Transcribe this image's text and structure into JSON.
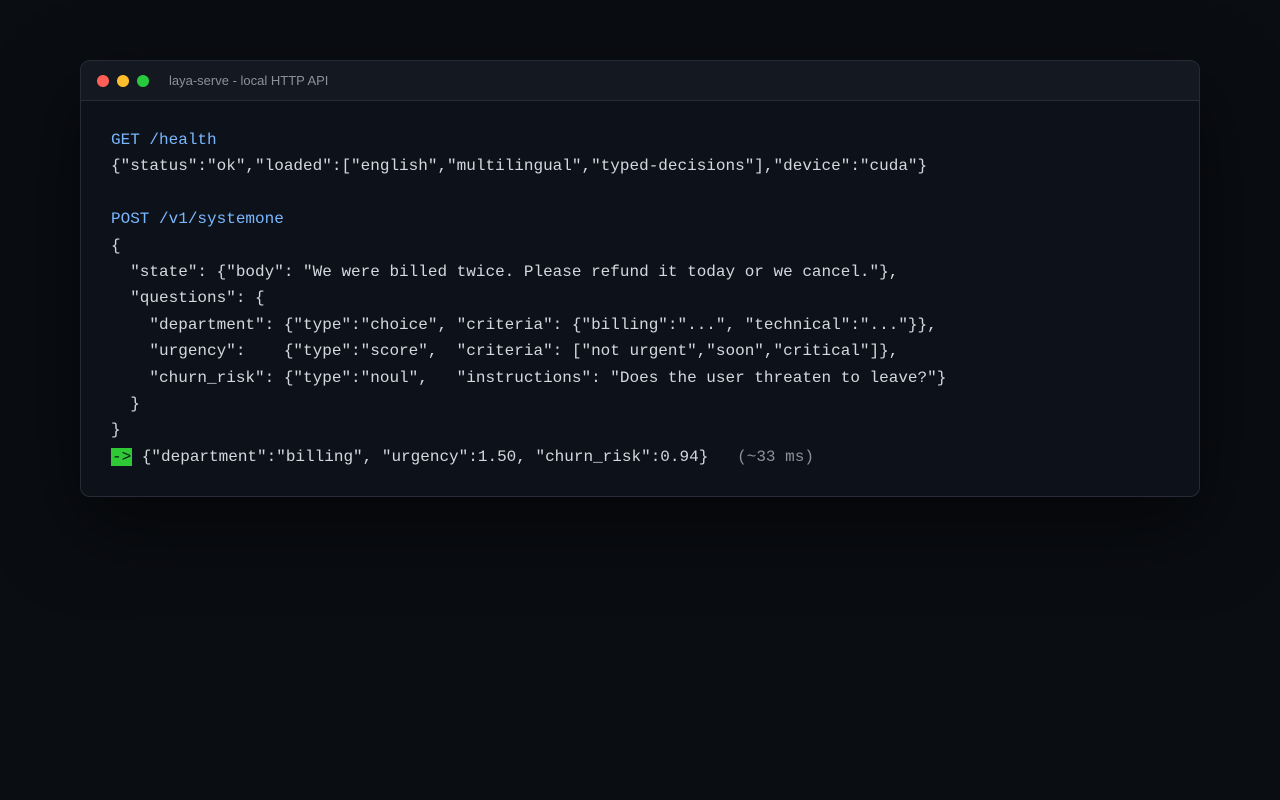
{
  "window": {
    "title": "laya-serve - local HTTP API"
  },
  "colors": {
    "background": "#0a0d12",
    "window_bg": "#0d111a",
    "method_blue": "#79b8ff",
    "arrow_green": "#2fc936",
    "text": "#d4d7dd",
    "muted": "#8a909c",
    "traffic_red": "#ff5f56",
    "traffic_yellow": "#ffbd2e",
    "traffic_green": "#27c93f"
  },
  "terminal": {
    "health_request": "GET /health",
    "health_response": "{\"status\":\"ok\",\"loaded\":[\"english\",\"multilingual\",\"typed-decisions\"],\"device\":\"cuda\"}",
    "post_request": "POST /v1/systemone",
    "body_lines": [
      "{",
      "  \"state\": {\"body\": \"We were billed twice. Please refund it today or we cancel.\"},",
      "  \"questions\": {",
      "    \"department\": {\"type\":\"choice\", \"criteria\": {\"billing\":\"...\", \"technical\":\"...\"}},",
      "    \"urgency\":    {\"type\":\"score\",  \"criteria\": [\"not urgent\",\"soon\",\"critical\"]},",
      "    \"churn_risk\": {\"type\":\"noul\",   \"instructions\": \"Does the user threaten to leave?\"}",
      "  }",
      "}"
    ],
    "arrow": "->",
    "result": " {\"department\":\"billing\", \"urgency\":1.50, \"churn_risk\":0.94}   ",
    "timing": "(~33 ms)"
  }
}
